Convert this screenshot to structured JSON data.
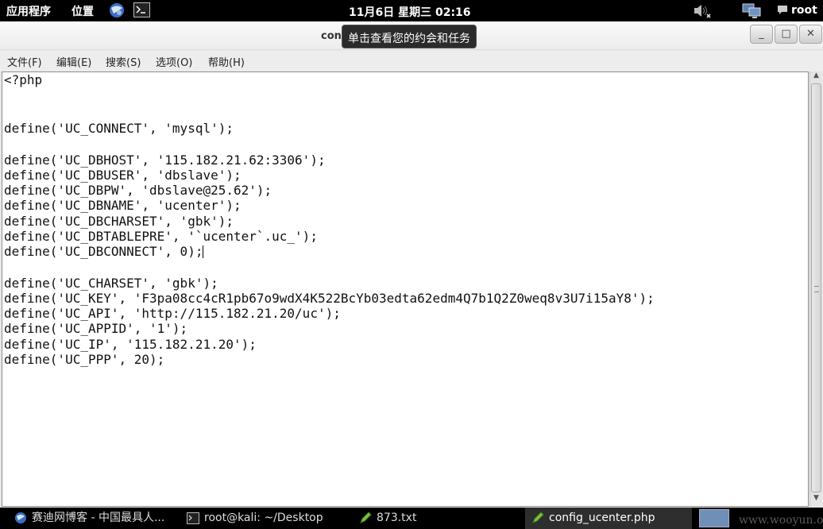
{
  "top_panel": {
    "apps_menu": "应用程序",
    "places_menu": "位置",
    "clock": "11月6日 星期三 02:16",
    "user": "root"
  },
  "window": {
    "title": "con",
    "tooltip": "单击查看您的约会和任务",
    "minimize": "_",
    "maximize": "□",
    "close": "✕"
  },
  "menubar": {
    "file": "文件(F)",
    "edit": "编辑(E)",
    "search": "搜索(S)",
    "options": "选项(O)",
    "help": "帮助(H)"
  },
  "code_lines": [
    "<?php",
    "",
    "",
    "define('UC_CONNECT', 'mysql');",
    "",
    "define('UC_DBHOST', '115.182.21.62:3306');",
    "define('UC_DBUSER', 'dbslave');",
    "define('UC_DBPW', 'dbslave@25.62');",
    "define('UC_DBNAME', 'ucenter');",
    "define('UC_DBCHARSET', 'gbk');",
    "define('UC_DBTABLEPRE', '`ucenter`.uc_');",
    "define('UC_DBCONNECT', 0);",
    "",
    "define('UC_CHARSET', 'gbk');",
    "define('UC_KEY', 'F3pa08cc4cR1pb67o9wdX4K522BcYb03edta62edm4Q7b1Q2Z0weq8v3U7i15aY8');",
    "define('UC_API', 'http://115.182.21.20/uc');",
    "define('UC_APPID', '1');",
    "define('UC_IP', '115.182.21.20');",
    "define('UC_PPP', 20);"
  ],
  "taskbar": {
    "browser": "赛迪网博客 - 中国最具人...",
    "terminal": "root@kali: ~/Desktop",
    "txt_file": "873.txt",
    "config_file": "config_ucenter.php",
    "watermark": "www.wooyun.org"
  },
  "icons": {
    "browser": "browser-globe-icon",
    "terminal": "terminal-icon",
    "volume": "volume-muted-icon",
    "network": "network-icon",
    "user": "user-chat-icon",
    "editor": "text-editor-icon"
  }
}
